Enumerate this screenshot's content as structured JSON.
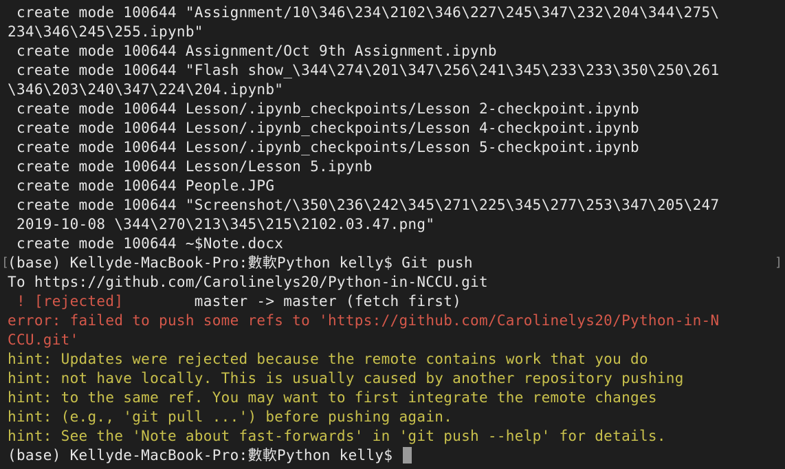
{
  "colors": {
    "background": "#1e1e1e",
    "default_text": "#e6e6e6",
    "error_red": "#d5584a",
    "hint_yellow": "#c9c14c",
    "cursor": "#9a9a9a"
  },
  "lines": [
    {
      "color": "default",
      "text": " create mode 100644 \"Assignment/10\\346\\234\\2102\\346\\227\\245\\347\\232\\204\\344\\275\\"
    },
    {
      "color": "default",
      "text": "234\\346\\245\\255.ipynb\""
    },
    {
      "color": "default",
      "text": " create mode 100644 Assignment/Oct 9th Assignment.ipynb"
    },
    {
      "color": "default",
      "text": " create mode 100644 \"Flash show_\\344\\274\\201\\347\\256\\241\\345\\233\\233\\350\\250\\261"
    },
    {
      "color": "default",
      "text": "\\346\\203\\240\\347\\224\\204.ipynb\""
    },
    {
      "color": "default",
      "text": " create mode 100644 Lesson/.ipynb_checkpoints/Lesson 2-checkpoint.ipynb"
    },
    {
      "color": "default",
      "text": " create mode 100644 Lesson/.ipynb_checkpoints/Lesson 4-checkpoint.ipynb"
    },
    {
      "color": "default",
      "text": " create mode 100644 Lesson/.ipynb_checkpoints/Lesson 5-checkpoint.ipynb"
    },
    {
      "color": "default",
      "text": " create mode 100644 Lesson/Lesson 5.ipynb"
    },
    {
      "color": "default",
      "text": " create mode 100644 People.JPG"
    },
    {
      "color": "default",
      "text": " create mode 100644 \"Screenshot/\\350\\236\\242\\345\\271\\225\\345\\277\\253\\347\\205\\247"
    },
    {
      "color": "default",
      "text": " 2019-10-08 \\344\\270\\213\\345\\215\\2102.03.47.png\""
    },
    {
      "color": "default",
      "text": " create mode 100644 ~$Note.docx"
    },
    {
      "color": "default",
      "text": "(base) Kellyde-MacBook-Pro:數軟Python kelly$ Git push"
    },
    {
      "color": "default",
      "text": "To https://github.com/Carolinelys20/Python-in-NCCU.git"
    },
    {
      "color": "mixed",
      "text_red": " ! [rejected]",
      "text_rest": "        master -> master (fetch first)"
    },
    {
      "color": "red",
      "text": "error: failed to push some refs to 'https://github.com/Carolinelys20/Python-in-N"
    },
    {
      "color": "red",
      "text": "CCU.git'"
    },
    {
      "color": "yellow",
      "text": "hint: Updates were rejected because the remote contains work that you do"
    },
    {
      "color": "yellow",
      "text": "hint: not have locally. This is usually caused by another repository pushing"
    },
    {
      "color": "yellow",
      "text": "hint: to the same ref. You may want to first integrate the remote changes"
    },
    {
      "color": "yellow",
      "text": "hint: (e.g., 'git pull ...') before pushing again."
    },
    {
      "color": "yellow",
      "text": "hint: See the 'Note about fast-forwards' in 'git push --help' for details."
    }
  ],
  "prompt": "(base) Kellyde-MacBook-Pro:數軟Python kelly$ "
}
